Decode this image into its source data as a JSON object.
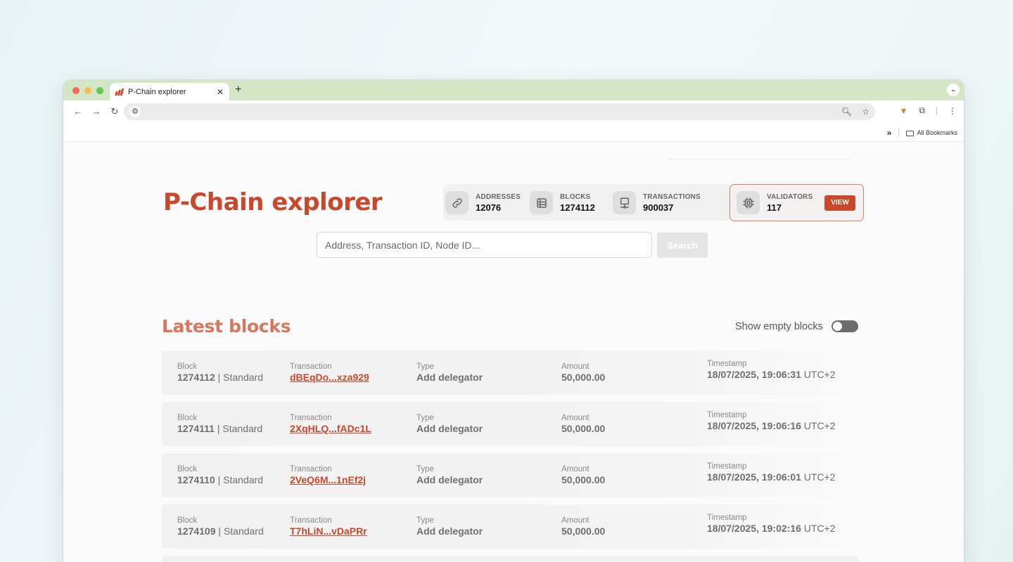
{
  "browser": {
    "tab_title": "P-Chain explorer",
    "new_tab": "+",
    "bookmarks_label": "All Bookmarks"
  },
  "header": {
    "title": "P-Chain explorer"
  },
  "stats": [
    {
      "label": "ADDRESSES",
      "value": "12076",
      "icon": "link-icon"
    },
    {
      "label": "BLOCKS",
      "value": "1274112",
      "icon": "block-icon"
    },
    {
      "label": "TRANSACTIONS",
      "value": "900037",
      "icon": "network-icon"
    }
  ],
  "validators": {
    "label": "VALIDATORS",
    "value": "117",
    "icon": "chip-icon",
    "button": "VIEW"
  },
  "search": {
    "placeholder": "Address, Transaction ID, Node ID...",
    "button": "Search"
  },
  "latest": {
    "title": "Latest blocks",
    "toggle_label": "Show empty blocks",
    "toggle_on": false,
    "col_block": "Block",
    "col_tx": "Transaction",
    "col_type": "Type",
    "col_amount": "Amount",
    "col_timestamp": "Timestamp",
    "rows": [
      {
        "block": "1274112",
        "kind": "Standard",
        "tx": "dBEqDo...xza929",
        "type": "Add delegator",
        "amount": "50,000.00",
        "timestamp": "18/07/2025, 19:06:31",
        "tz": "UTC+2"
      },
      {
        "block": "1274111",
        "kind": "Standard",
        "tx": "2XqHLQ...fADc1L",
        "type": "Add delegator",
        "amount": "50,000.00",
        "timestamp": "18/07/2025, 19:06:16",
        "tz": "UTC+2"
      },
      {
        "block": "1274110",
        "kind": "Standard",
        "tx": "2VeQ6M...1nEf2j",
        "type": "Add delegator",
        "amount": "50,000.00",
        "timestamp": "18/07/2025, 19:06:01",
        "tz": "UTC+2"
      },
      {
        "block": "1274109",
        "kind": "Standard",
        "tx": "T7hLiN...vDaPRr",
        "type": "Add delegator",
        "amount": "50,000.00",
        "timestamp": "18/07/2025, 19:02:16",
        "tz": "UTC+2"
      }
    ]
  },
  "colors": {
    "accent": "#c9482b",
    "section_title": "#d8775e",
    "tabstrip": "#d3e7c6"
  }
}
